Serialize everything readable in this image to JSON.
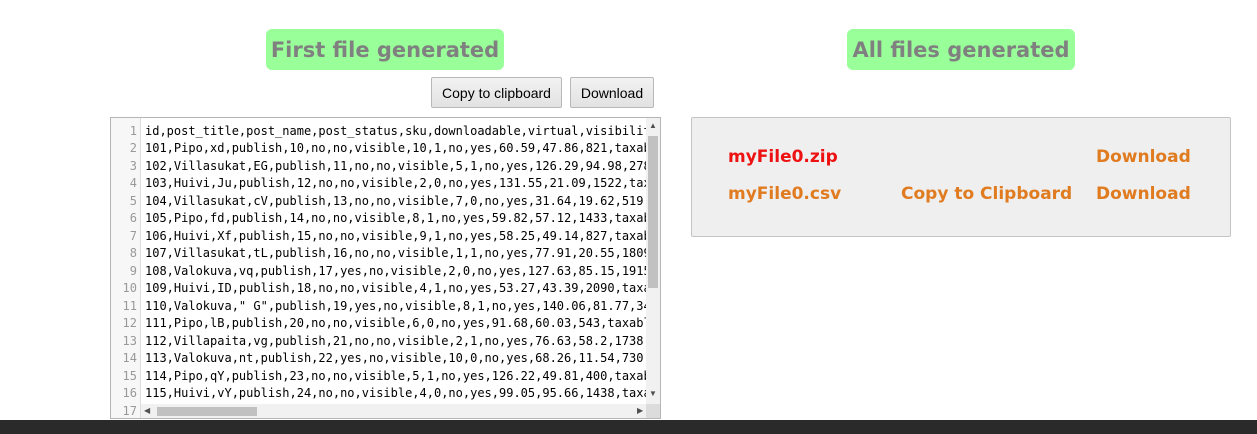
{
  "left": {
    "title": "First file generated",
    "copy_label": "Copy to clipboard",
    "download_label": "Download",
    "lines": [
      {
        "n": "1",
        "text": "id,post_title,post_name,post_status,sku,downloadable,virtual,visibilit"
      },
      {
        "n": "2",
        "text": "101,Pipo,xd,publish,10,no,no,visible,10,1,no,yes,60.59,47.86,821,taxab"
      },
      {
        "n": "3",
        "text": "102,Villasukat,EG,publish,11,no,no,visible,5,1,no,yes,126.29,94.98,278"
      },
      {
        "n": "4",
        "text": "103,Huivi,Ju,publish,12,no,no,visible,2,0,no,yes,131.55,21.09,1522,tax"
      },
      {
        "n": "5",
        "text": "104,Villasukat,cV,publish,13,no,no,visible,7,0,no,yes,31.64,19.62,519,"
      },
      {
        "n": "6",
        "text": "105,Pipo,fd,publish,14,no,no,visible,8,1,no,yes,59.82,57.12,1433,taxab"
      },
      {
        "n": "7",
        "text": "106,Huivi,Xf,publish,15,no,no,visible,9,1,no,yes,58.25,49.14,827,taxab"
      },
      {
        "n": "8",
        "text": "107,Villasukat,tL,publish,16,no,no,visible,1,1,no,yes,77.91,20.55,1809"
      },
      {
        "n": "9",
        "text": "108,Valokuva,vq,publish,17,yes,no,visible,2,0,no,yes,127.63,85.15,1915"
      },
      {
        "n": "10",
        "text": "109,Huivi,ID,publish,18,no,no,visible,4,1,no,yes,53.27,43.39,2090,taxa"
      },
      {
        "n": "11",
        "text": "110,Valokuva,\" G\",publish,19,yes,no,visible,8,1,no,yes,140.06,81.77,34"
      },
      {
        "n": "12",
        "text": "111,Pipo,lB,publish,20,no,no,visible,6,0,no,yes,91.68,60.03,543,taxabl"
      },
      {
        "n": "13",
        "text": "112,Villapaita,vg,publish,21,no,no,visible,2,1,no,yes,76.63,58.2,1738,"
      },
      {
        "n": "14",
        "text": "113,Valokuva,nt,publish,22,yes,no,visible,10,0,no,yes,68.26,11.54,730,"
      },
      {
        "n": "15",
        "text": "114,Pipo,qY,publish,23,no,no,visible,5,1,no,yes,126.22,49.81,400,taxab"
      },
      {
        "n": "16",
        "text": "115,Huivi,vY,publish,24,no,no,visible,4,0,no,yes,99.05,95.66,1438,taxa"
      },
      {
        "n": "17",
        "text": ""
      }
    ]
  },
  "right": {
    "title": "All files generated",
    "files": [
      {
        "name": "myFile0.zip",
        "copy": "",
        "download": "Download"
      },
      {
        "name": "myFile0.csv",
        "copy": "Copy to Clipboard",
        "download": "Download"
      }
    ]
  },
  "colors": {
    "badge_bg": "#99ff99",
    "badge_text": "#808080",
    "zip_link": "#ee1111",
    "link": "#e07b1f"
  }
}
